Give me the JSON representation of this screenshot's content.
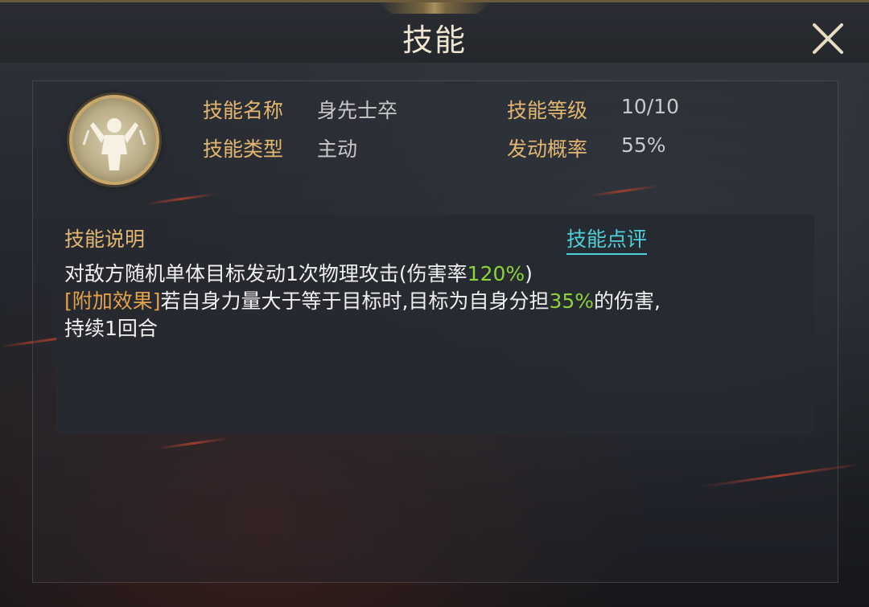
{
  "header": {
    "title": "技能",
    "close_icon": "close-icon"
  },
  "skill": {
    "icon": "warrior-figure-icon",
    "name_label": "技能名称",
    "name_value": "身先士卒",
    "type_label": "技能类型",
    "type_value": "主动",
    "level_label": "技能等级",
    "level_value": "10/10",
    "chance_label": "发动概率",
    "chance_value": "55%"
  },
  "description": {
    "title": "技能说明",
    "review_link": "技能点评",
    "line1_text": "对敌方随机单体目标发动1次物理攻击(伤害率",
    "line1_highlight": "120%",
    "line1_end": ")",
    "line2_bracket": "[附加效果]",
    "line2_text": "若自身力量大于等于目标时,目标为自身分担",
    "line2_highlight": "35%",
    "line2_end": "的伤害,",
    "line3_text": "持续1回合"
  },
  "colors": {
    "label": "#e3b770",
    "highlight": "#8ed334",
    "link": "#4fd0d8",
    "title": "#f1e6cf"
  }
}
